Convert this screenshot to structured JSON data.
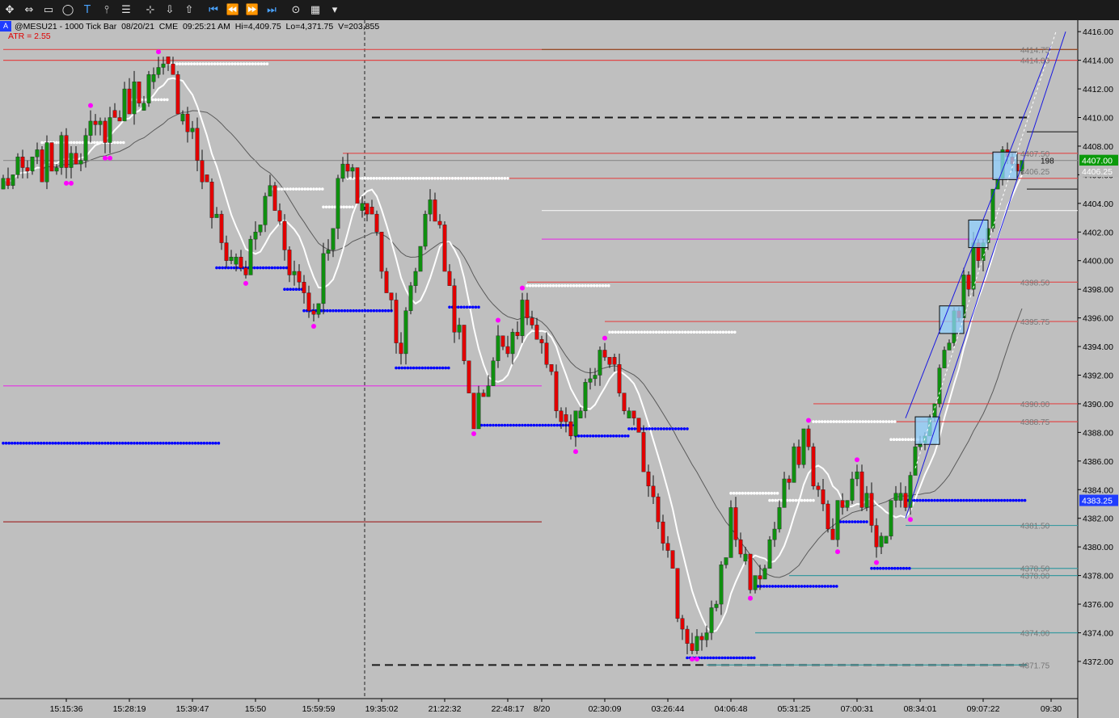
{
  "toolbar": {
    "buttons": [
      {
        "icon": "cross-arrows-icon",
        "glyph": "✥"
      },
      {
        "icon": "horizontal-arrows-icon",
        "glyph": "⇔"
      },
      {
        "icon": "rectangle-icon",
        "glyph": "▭"
      },
      {
        "icon": "ellipse-icon",
        "glyph": "◯"
      },
      {
        "icon": "text-icon",
        "glyph": "T"
      },
      {
        "icon": "fork-icon",
        "glyph": "⫯"
      },
      {
        "icon": "lines-icon",
        "glyph": "☰"
      },
      {
        "icon": "fib-tool-icon",
        "glyph": "⊹"
      },
      {
        "icon": "arrow-down-icon",
        "glyph": "⇩"
      },
      {
        "icon": "arrow-up-icon",
        "glyph": "⇧"
      },
      {
        "icon": "go-first-icon",
        "glyph": "⏮"
      },
      {
        "icon": "rewind-icon",
        "glyph": "⏪"
      },
      {
        "icon": "forward-icon",
        "glyph": "⏩"
      },
      {
        "icon": "go-last-icon",
        "glyph": "⏭"
      },
      {
        "icon": "settings-icon",
        "glyph": "⊙"
      },
      {
        "icon": "data-box-icon",
        "glyph": "▦"
      },
      {
        "icon": "dropdown-icon",
        "glyph": "▾"
      }
    ]
  },
  "header": {
    "badge": "A",
    "symbol": "@MESU21 - 1000 Tick Bar",
    "date": "08/20/21",
    "exchange": "CME",
    "time": "09:25:21 AM",
    "hi": "Hi=4,409.75",
    "lo": "Lo=4,371.75",
    "volume": "V=203,855"
  },
  "atr_label": "ATR  = 2.55",
  "colors": {
    "background": "#bfbfbf",
    "up_candle": "#0f8f0f",
    "down_candle": "#e00000",
    "ma_fast": "#ffffff",
    "ma_slow": "#5a5a5a",
    "pivot_high": "#ff00ff",
    "pivot_low": "#ff00ff",
    "resistance_dots": "#ffffff",
    "support_dots": "#0000ff",
    "red_level": "#e05050",
    "magenta_level": "#e040e0",
    "teal_level": "#3aa0a0",
    "channel": "#1a1ae0",
    "last_price_tag": "#0a9a0a",
    "bid_tag": "#1f3cff"
  },
  "chart_data": {
    "type": "candlestick",
    "y_axis": {
      "range": [
        4369.4,
        4416.8
      ],
      "ticks": [
        4416,
        4414,
        4412,
        4410,
        4408,
        4406,
        4404,
        4402,
        4400,
        4398,
        4396,
        4394,
        4392,
        4390,
        4388,
        4386,
        4384,
        4382,
        4380,
        4378,
        4376,
        4374,
        4372
      ],
      "tick_labels": [
        "4416.00",
        "4414.00",
        "4412.00",
        "4410.00",
        "4408.00",
        "4406.00",
        "4404.00",
        "4402.00",
        "4400.00",
        "4398.00",
        "4396.00",
        "4394.00",
        "4392.00",
        "4390.00",
        "4388.00",
        "4386.00",
        "4384.00",
        "4382.00",
        "4380.00",
        "4378.00",
        "4376.00",
        "4374.00",
        "4372.00"
      ]
    },
    "x_axis": {
      "bar_count": 211,
      "tick_labels": [
        "15:15:36",
        "15:28:19",
        "15:39:47",
        "15:50",
        "15:59:59",
        "19:35:02",
        "21:22:32",
        "22:48:17",
        "8/20",
        "02:30:09",
        "03:26:44",
        "04:06:48",
        "05:31:25",
        "07:00:31",
        "08:34:01",
        "09:07:22",
        "09:30"
      ],
      "tick_bar_index": [
        13,
        26,
        39,
        52,
        65,
        78,
        91,
        104,
        111,
        124,
        137,
        150,
        163,
        176,
        189,
        202,
        216
      ]
    },
    "close_anchors": [
      {
        "bar": 0,
        "close": 4405.5
      },
      {
        "bar": 10,
        "close": 4407.0
      },
      {
        "bar": 20,
        "close": 4409.0
      },
      {
        "bar": 28,
        "close": 4412.0
      },
      {
        "bar": 34,
        "close": 4413.0
      },
      {
        "bar": 38,
        "close": 4410.0
      },
      {
        "bar": 45,
        "close": 4401.0
      },
      {
        "bar": 50,
        "close": 4399.5
      },
      {
        "bar": 55,
        "close": 4405.0
      },
      {
        "bar": 60,
        "close": 4399.0
      },
      {
        "bar": 64,
        "close": 4396.5
      },
      {
        "bar": 70,
        "close": 4406.5
      },
      {
        "bar": 76,
        "close": 4403.0
      },
      {
        "bar": 82,
        "close": 4394.0
      },
      {
        "bar": 88,
        "close": 4405.0
      },
      {
        "bar": 92,
        "close": 4398.0
      },
      {
        "bar": 97,
        "close": 4389.0
      },
      {
        "bar": 102,
        "close": 4394.0
      },
      {
        "bar": 108,
        "close": 4396.5
      },
      {
        "bar": 113,
        "close": 4391.0
      },
      {
        "bar": 117,
        "close": 4388.0
      },
      {
        "bar": 124,
        "close": 4393.5
      },
      {
        "bar": 130,
        "close": 4388.0
      },
      {
        "bar": 135,
        "close": 4383.0
      },
      {
        "bar": 140,
        "close": 4374.0
      },
      {
        "bar": 145,
        "close": 4373.0
      },
      {
        "bar": 150,
        "close": 4382.0
      },
      {
        "bar": 155,
        "close": 4377.0
      },
      {
        "bar": 160,
        "close": 4382.5
      },
      {
        "bar": 165,
        "close": 4388.0
      },
      {
        "bar": 170,
        "close": 4381.0
      },
      {
        "bar": 176,
        "close": 4384.5
      },
      {
        "bar": 180,
        "close": 4381.0
      },
      {
        "bar": 186,
        "close": 4384.0
      },
      {
        "bar": 190,
        "close": 4388.5
      },
      {
        "bar": 196,
        "close": 4396.0
      },
      {
        "bar": 202,
        "close": 4402.0
      },
      {
        "bar": 207,
        "close": 4408.5
      },
      {
        "bar": 210,
        "close": 4407.0
      }
    ],
    "price_tags": [
      {
        "label": "4407.00",
        "price": 4407.0,
        "kind": "last"
      },
      {
        "label": "4406.25",
        "price": 4406.25,
        "kind": "grey"
      },
      {
        "label": "4383.25",
        "price": 4383.25,
        "kind": "bid"
      }
    ],
    "level_labels": [
      {
        "label": "4414.75",
        "price": 4414.75
      },
      {
        "label": "4414.00",
        "price": 4414.0
      },
      {
        "label": "4407.50",
        "price": 4407.5
      },
      {
        "label": "198",
        "price": 4407.0
      },
      {
        "label": "4406.25",
        "price": 4406.25
      },
      {
        "label": "4398.50",
        "price": 4398.5
      },
      {
        "label": "4395.75",
        "price": 4395.75
      },
      {
        "label": "4390.00",
        "price": 4390.0
      },
      {
        "label": "4388.75",
        "price": 4388.75
      },
      {
        "label": "4381.50",
        "price": 4381.5
      },
      {
        "label": "4378.50",
        "price": 4378.5
      },
      {
        "label": "4378.00",
        "price": 4378.0
      },
      {
        "label": "4374.00",
        "price": 4374.0
      },
      {
        "label": "4371.75",
        "price": 4371.75
      }
    ],
    "horizontal_levels": [
      {
        "price": 4414.75,
        "from_bar": 0,
        "to_bar": 222,
        "kind": "red"
      },
      {
        "price": 4414.0,
        "from_bar": 0,
        "to_bar": 222,
        "kind": "red"
      },
      {
        "price": 4414.75,
        "from_bar": 111,
        "to_bar": 222,
        "kind": "brown"
      },
      {
        "price": 4410.0,
        "from_bar": 76,
        "to_bar": 211,
        "kind": "dash-black"
      },
      {
        "price": 4409.0,
        "from_bar": 211,
        "to_bar": 222,
        "kind": "dark"
      },
      {
        "price": 4407.5,
        "from_bar": 70,
        "to_bar": 222,
        "kind": "red"
      },
      {
        "price": 4407.0,
        "from_bar": 0,
        "to_bar": 222,
        "kind": "grey"
      },
      {
        "price": 4405.75,
        "from_bar": 88,
        "to_bar": 222,
        "kind": "red"
      },
      {
        "price": 4405.0,
        "from_bar": 211,
        "to_bar": 222,
        "kind": "dark"
      },
      {
        "price": 4403.5,
        "from_bar": 111,
        "to_bar": 222,
        "kind": "white"
      },
      {
        "price": 4401.5,
        "from_bar": 111,
        "to_bar": 222,
        "kind": "magenta"
      },
      {
        "price": 4398.5,
        "from_bar": 108,
        "to_bar": 222,
        "kind": "red"
      },
      {
        "price": 4395.75,
        "from_bar": 124,
        "to_bar": 222,
        "kind": "red"
      },
      {
        "price": 4391.25,
        "from_bar": 0,
        "to_bar": 111,
        "kind": "magenta"
      },
      {
        "price": 4390.0,
        "from_bar": 167,
        "to_bar": 222,
        "kind": "red"
      },
      {
        "price": 4388.75,
        "from_bar": 183,
        "to_bar": 222,
        "kind": "red"
      },
      {
        "price": 4381.75,
        "from_bar": 0,
        "to_bar": 111,
        "kind": "red-dark"
      },
      {
        "price": 4381.5,
        "from_bar": 186,
        "to_bar": 222,
        "kind": "teal"
      },
      {
        "price": 4378.5,
        "from_bar": 180,
        "to_bar": 222,
        "kind": "teal"
      },
      {
        "price": 4378.0,
        "from_bar": 162,
        "to_bar": 222,
        "kind": "teal"
      },
      {
        "price": 4374.0,
        "from_bar": 155,
        "to_bar": 222,
        "kind": "teal"
      },
      {
        "price": 4371.75,
        "from_bar": 76,
        "to_bar": 211,
        "kind": "dash-black"
      },
      {
        "price": 4371.75,
        "from_bar": 145,
        "to_bar": 211,
        "kind": "teal"
      }
    ],
    "dot_levels": [
      {
        "price": 4413.75,
        "from_bar": 34,
        "to_bar": 55,
        "kind": "white"
      },
      {
        "price": 4411.25,
        "from_bar": 26,
        "to_bar": 34,
        "kind": "white"
      },
      {
        "price": 4408.25,
        "from_bar": 8,
        "to_bar": 25,
        "kind": "white"
      },
      {
        "price": 4405.75,
        "from_bar": 71,
        "to_bar": 104,
        "kind": "white"
      },
      {
        "price": 4405.0,
        "from_bar": 55,
        "to_bar": 66,
        "kind": "white"
      },
      {
        "price": 4403.75,
        "from_bar": 66,
        "to_bar": 72,
        "kind": "white"
      },
      {
        "price": 4398.25,
        "from_bar": 108,
        "to_bar": 125,
        "kind": "white"
      },
      {
        "price": 4395.0,
        "from_bar": 125,
        "to_bar": 151,
        "kind": "white"
      },
      {
        "price": 4399.5,
        "from_bar": 44,
        "to_bar": 59,
        "kind": "blue"
      },
      {
        "price": 4398.0,
        "from_bar": 58,
        "to_bar": 62,
        "kind": "blue"
      },
      {
        "price": 4396.5,
        "from_bar": 62,
        "to_bar": 80,
        "kind": "blue"
      },
      {
        "price": 4396.75,
        "from_bar": 92,
        "to_bar": 98,
        "kind": "blue"
      },
      {
        "price": 4392.5,
        "from_bar": 81,
        "to_bar": 92,
        "kind": "blue"
      },
      {
        "price": 4388.5,
        "from_bar": 98,
        "to_bar": 118,
        "kind": "blue"
      },
      {
        "price": 4387.75,
        "from_bar": 118,
        "to_bar": 129,
        "kind": "blue"
      },
      {
        "price": 4388.25,
        "from_bar": 129,
        "to_bar": 141,
        "kind": "blue"
      },
      {
        "price": 4387.25,
        "from_bar": 0,
        "to_bar": 45,
        "kind": "blue"
      },
      {
        "price": 4388.75,
        "from_bar": 167,
        "to_bar": 184,
        "kind": "white"
      },
      {
        "price": 4383.75,
        "from_bar": 150,
        "to_bar": 160,
        "kind": "white"
      },
      {
        "price": 4383.25,
        "from_bar": 158,
        "to_bar": 167,
        "kind": "white"
      },
      {
        "price": 4387.5,
        "from_bar": 183,
        "to_bar": 190,
        "kind": "white"
      },
      {
        "price": 4383.25,
        "from_bar": 186,
        "to_bar": 211,
        "kind": "blue"
      },
      {
        "price": 4381.75,
        "from_bar": 172,
        "to_bar": 178,
        "kind": "blue"
      },
      {
        "price": 4378.5,
        "from_bar": 179,
        "to_bar": 187,
        "kind": "blue"
      },
      {
        "price": 4377.25,
        "from_bar": 155,
        "to_bar": 172,
        "kind": "blue"
      },
      {
        "price": 4372.25,
        "from_bar": 141,
        "to_bar": 155,
        "kind": "blue"
      }
    ],
    "highlight_boxes": [
      {
        "from_bar": 188,
        "to_bar": 193,
        "top": 4388.75,
        "bottom": 4387.5
      },
      {
        "from_bar": 193,
        "to_bar": 198,
        "top": 4396.5,
        "bottom": 4395.25
      },
      {
        "from_bar": 199,
        "to_bar": 203,
        "top": 4402.5,
        "bottom": 4401.25
      },
      {
        "from_bar": 204,
        "to_bar": 209,
        "top": 4407.25,
        "bottom": 4406.0
      }
    ],
    "channel_lines": [
      {
        "from_bar": 186,
        "from_price": 4389.0,
        "to_bar": 216,
        "to_price": 4415.0
      },
      {
        "from_bar": 186,
        "from_price": 4382.0,
        "to_bar": 219,
        "to_price": 4416.0
      }
    ]
  }
}
